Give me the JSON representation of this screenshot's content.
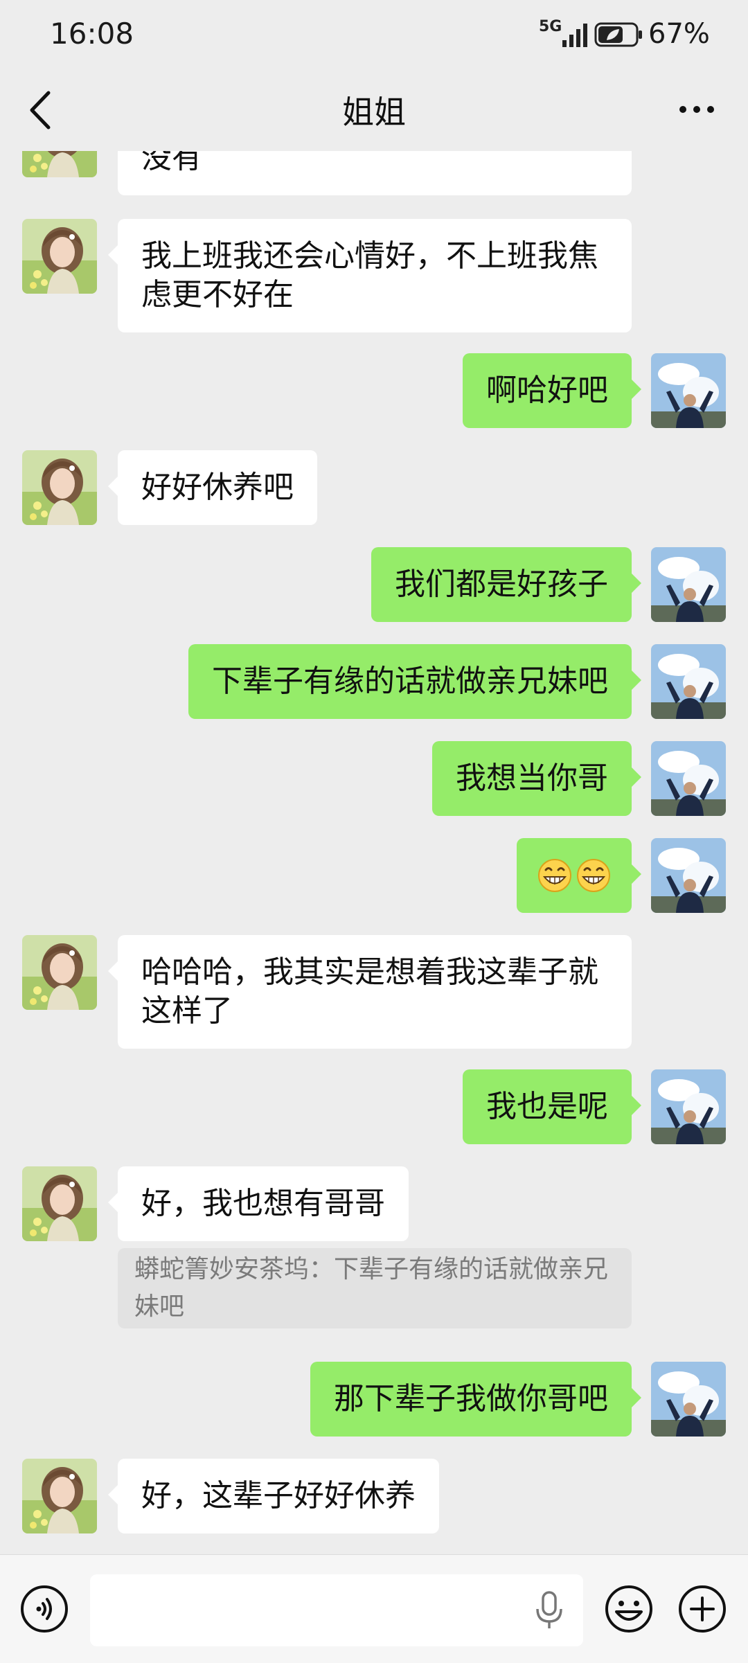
{
  "status_bar": {
    "time": "16:08",
    "network": "5G",
    "battery_percent": "67%",
    "battery_level": 0.67
  },
  "header": {
    "title": "姐姐",
    "back_icon": "chevron-left-icon",
    "more_icon": "more-dots-icon"
  },
  "colors": {
    "background": "#ededed",
    "incoming_bubble": "#ffffff",
    "outgoing_bubble": "#95ec69",
    "quote_background": "#e2e2e2",
    "quote_text": "#7a7a7a"
  },
  "messages": [
    {
      "side": "in",
      "text": "没有"
    },
    {
      "side": "in",
      "text": "我上班我还会心情好，不上班我焦虑更不好在"
    },
    {
      "side": "out",
      "text": "啊哈好吧"
    },
    {
      "side": "in",
      "text": "好好休养吧"
    },
    {
      "side": "out",
      "text": "我们都是好孩子"
    },
    {
      "side": "out",
      "text": "下辈子有缘的话就做亲兄妹吧"
    },
    {
      "side": "out",
      "text": "我想当你哥"
    },
    {
      "side": "out",
      "emoji": [
        "grin-emoji",
        "grin-emoji"
      ]
    },
    {
      "side": "in",
      "text": "哈哈哈，我其实是想着我这辈子就这样了"
    },
    {
      "side": "out",
      "text": "我也是呢"
    },
    {
      "side": "in",
      "text": "好，我也想有哥哥",
      "quote": "蟒蛇箐妙安茶坞：下辈子有缘的话就做亲兄妹吧"
    },
    {
      "side": "out",
      "text": "那下辈子我做你哥吧"
    },
    {
      "side": "in",
      "text": "好，这辈子好好休养"
    }
  ],
  "input_bar": {
    "value": "",
    "voice_icon": "voice-wave-icon",
    "mic_icon": "microphone-icon",
    "emoji_icon": "smiley-icon",
    "plus_icon": "plus-circle-icon"
  }
}
